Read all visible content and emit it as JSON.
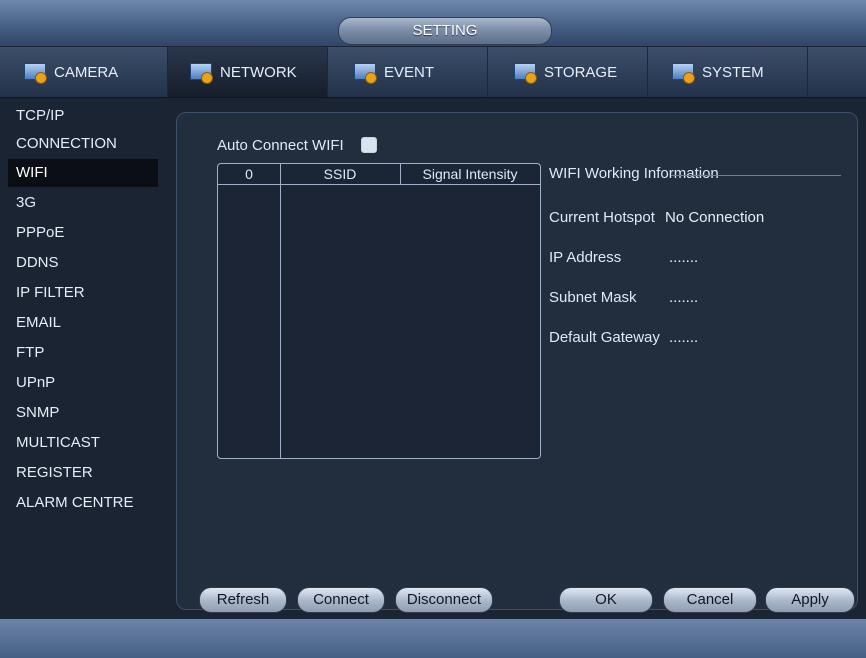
{
  "window": {
    "title": "SETTING"
  },
  "tabs": [
    {
      "label": "CAMERA",
      "icon": "camera-icon",
      "active": false
    },
    {
      "label": "NETWORK",
      "icon": "network-icon",
      "active": true
    },
    {
      "label": "EVENT",
      "icon": "event-icon",
      "active": false
    },
    {
      "label": "STORAGE",
      "icon": "storage-icon",
      "active": false
    },
    {
      "label": "SYSTEM",
      "icon": "system-icon",
      "active": false
    }
  ],
  "sidebar": {
    "items": [
      {
        "label": "TCP/IP"
      },
      {
        "label": "CONNECTION"
      },
      {
        "label": "WIFI",
        "active": true
      },
      {
        "label": "3G"
      },
      {
        "label": "PPPoE"
      },
      {
        "label": "DDNS"
      },
      {
        "label": "IP FILTER"
      },
      {
        "label": "EMAIL"
      },
      {
        "label": "FTP"
      },
      {
        "label": "UPnP"
      },
      {
        "label": "SNMP"
      },
      {
        "label": "MULTICAST"
      },
      {
        "label": "REGISTER"
      },
      {
        "label": "ALARM CENTRE"
      }
    ]
  },
  "wifi": {
    "auto_connect_label": "Auto Connect WIFI",
    "auto_connect_checked": false,
    "table": {
      "columns": [
        "0",
        "SSID",
        "Signal Intensity"
      ],
      "rows": []
    },
    "info": {
      "title": "WIFI Working Information",
      "current_hotspot_label": "Current Hotspot",
      "current_hotspot_value": "No Connection",
      "ip_label": "IP Address",
      "ip_value": ".......",
      "subnet_label": "Subnet Mask",
      "subnet_value": ".......",
      "gateway_label": "Default Gateway",
      "gateway_value": "......."
    }
  },
  "buttons": {
    "refresh": "Refresh",
    "connect": "Connect",
    "disconnect": "Disconnect",
    "ok": "OK",
    "cancel": "Cancel",
    "apply": "Apply"
  },
  "colors": {
    "accent": "#5b7aa6",
    "panel": "#222d3e",
    "sidebar_active": "#0b0f15"
  }
}
